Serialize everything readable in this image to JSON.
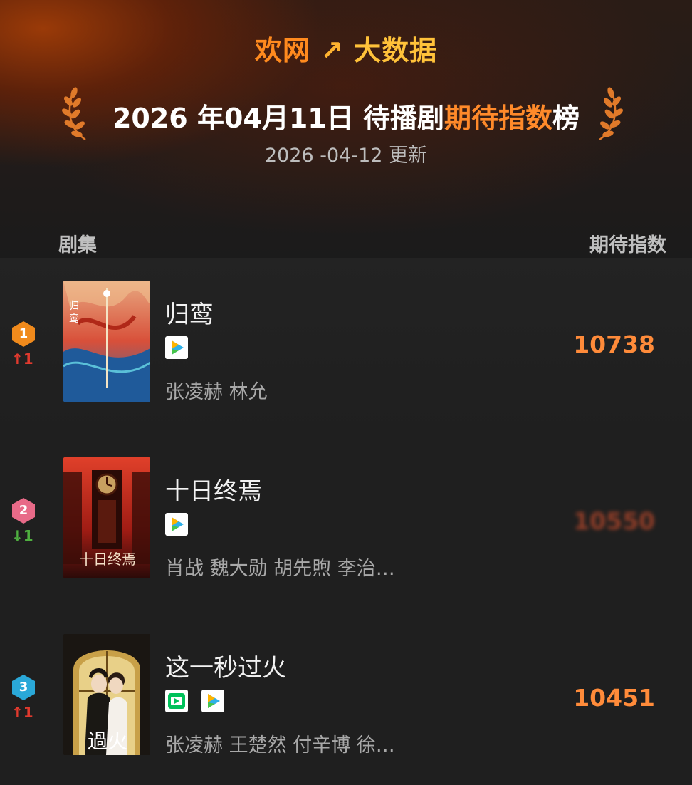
{
  "brand": {
    "part1": "欢网",
    "part2": "↗",
    "part3": "大数据"
  },
  "title": {
    "prefix": "2026 年04月11日 待播剧",
    "highlight": "期待指数",
    "suffix": "榜"
  },
  "subtitle": "2026 -04-12 更新",
  "columns": {
    "left": "剧集",
    "right": "期待指数"
  },
  "colors": {
    "accent": "#ff8b3a",
    "up": "#e03a2e",
    "down": "#4fb040",
    "rank1": "#f08a1c",
    "rank2": "#e86a88",
    "rank3": "#2aa8d8"
  },
  "rows": [
    {
      "rank": "1",
      "change": "↑1",
      "direction": "up",
      "name": "归鸾",
      "cast": "张凌赫 林允",
      "score": "10738",
      "platforms": [
        "tencent-video-icon"
      ]
    },
    {
      "rank": "2",
      "change": "↓1",
      "direction": "down",
      "name": "十日终焉",
      "cast": "肖战 魏大勋 胡先煦 李治…",
      "score": "10550",
      "platforms": [
        "tencent-video-icon"
      ]
    },
    {
      "rank": "3",
      "change": "↑1",
      "direction": "up",
      "name": "这一秒过火",
      "cast": "张凌赫 王楚然 付辛博 徐…",
      "score": "10451",
      "platforms": [
        "iqiyi-icon",
        "tencent-video-icon"
      ]
    }
  ]
}
